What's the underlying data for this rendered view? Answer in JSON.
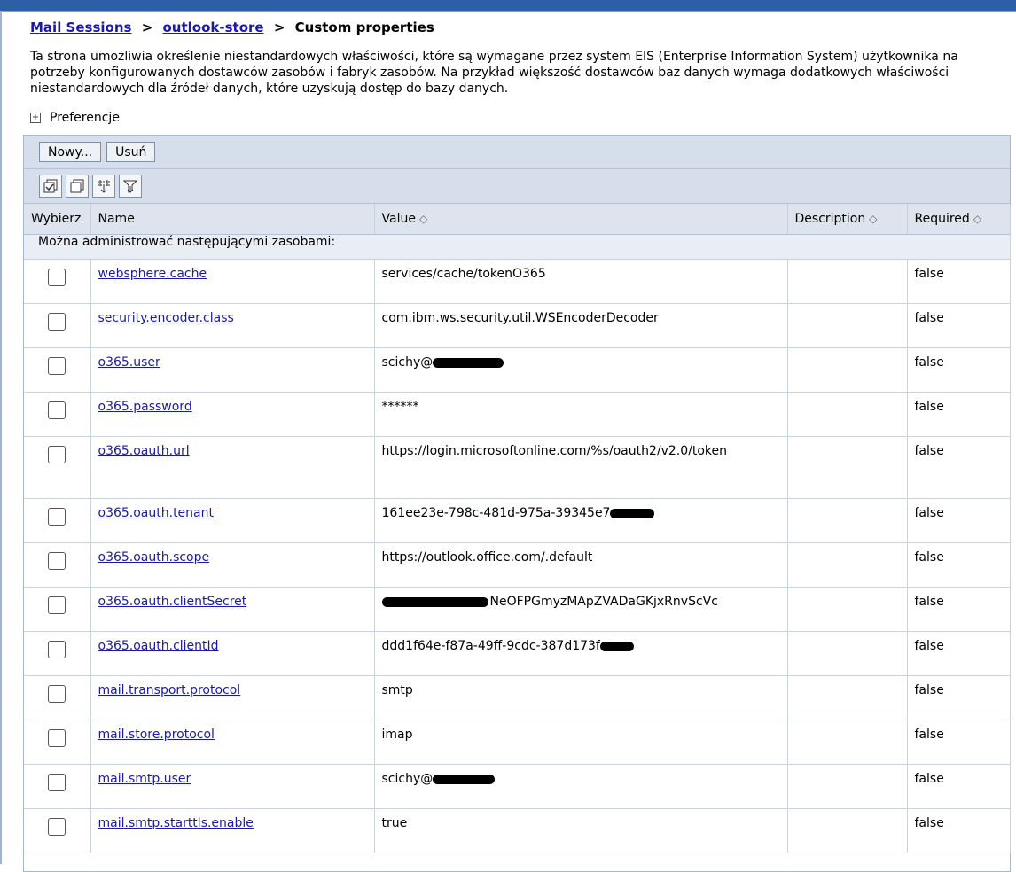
{
  "breadcrumb": {
    "item1": "Mail Sessions",
    "item2": "outlook-store",
    "current": "Custom properties",
    "sep": ">"
  },
  "description": "Ta strona umożliwia określenie niestandardowych właściwości, które są wymagane przez system EIS (Enterprise Information System) użytkownika na potrzeby konfigurowanych dostawców zasobów i fabryk zasobów. Na przykład większość dostawców baz danych wymaga dodatkowych właściwości niestandardowych dla źródeł danych, które uzyskują dostęp do bazy danych.",
  "preferences": "Preferencje",
  "buttons": {
    "new": "Nowy...",
    "delete": "Usuń"
  },
  "icons": [
    "select-all-icon",
    "deselect-all-icon",
    "show-filter-icon",
    "clear-filter-icon"
  ],
  "table": {
    "headers": {
      "select": "Wybierz",
      "name": "Name",
      "value": "Value",
      "description": "Description",
      "required": "Required"
    },
    "sort_glyph": "◇",
    "group_label": "Można administrować następującymi zasobami:",
    "rows": [
      {
        "name": "websphere.cache",
        "value": "services/cache/tokenO365",
        "description": "",
        "required": "false"
      },
      {
        "name": "security.encoder.class",
        "value": "com.ibm.ws.security.util.WSEncoderDecoder",
        "description": "",
        "required": "false"
      },
      {
        "name": "o365.user",
        "value": "scichy@",
        "description": "",
        "required": "false"
      },
      {
        "name": "o365.password",
        "value": "******",
        "description": "",
        "required": "false"
      },
      {
        "name": "o365.oauth.url",
        "value": "https://login.microsoftonline.com/%s/oauth2/v2.0/token",
        "description": "",
        "required": "false"
      },
      {
        "name": "o365.oauth.tenant",
        "value": "161ee23e-798c-481d-975a-39345e7",
        "description": "",
        "required": "false"
      },
      {
        "name": "o365.oauth.scope",
        "value": "https://outlook.office.com/.default",
        "description": "",
        "required": "false"
      },
      {
        "name": "o365.oauth.clientSecret",
        "value": "NeOFPGmyzMApZVADaGKjxRnvScVc",
        "description": "",
        "required": "false"
      },
      {
        "name": "o365.oauth.clientId",
        "value": "ddd1f64e-f87a-49ff-9cdc-387d173f",
        "description": "",
        "required": "false"
      },
      {
        "name": "mail.transport.protocol",
        "value": "smtp",
        "description": "",
        "required": "false"
      },
      {
        "name": "mail.store.protocol",
        "value": "imap",
        "description": "",
        "required": "false"
      },
      {
        "name": "mail.smtp.user",
        "value": "scichy@",
        "description": "",
        "required": "false"
      },
      {
        "name": "mail.smtp.starttls.enable",
        "value": "true",
        "description": "",
        "required": "false"
      }
    ]
  }
}
